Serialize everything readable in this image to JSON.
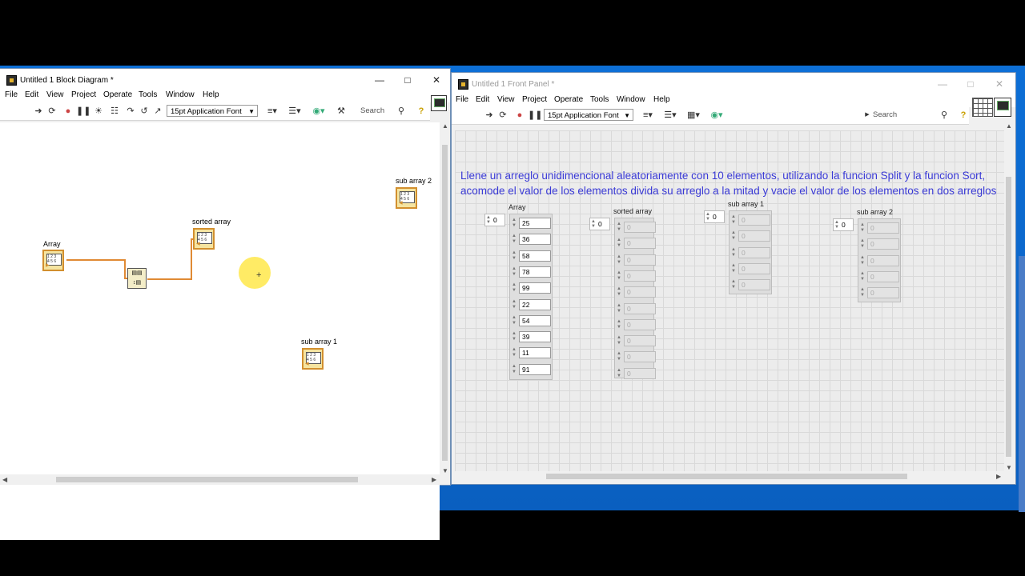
{
  "block_diagram": {
    "title": "Untitled 1 Block Diagram *",
    "menu": [
      "File",
      "Edit",
      "View",
      "Project",
      "Operate",
      "Tools",
      "Window",
      "Help"
    ],
    "font": "15pt Application Font",
    "search_placeholder": "Search",
    "terminals": {
      "array": "Array",
      "sorted": "sorted array",
      "sub1": "sub array 1",
      "sub2": "sub array 2"
    }
  },
  "front_panel": {
    "title": "Untitled 1 Front Panel *",
    "menu": [
      "File",
      "Edit",
      "View",
      "Project",
      "Operate",
      "Tools",
      "Window",
      "Help"
    ],
    "font": "15pt Application Font",
    "search_placeholder": "Search",
    "instructions_line1": "Llene un arreglo unidimencional aleatoriamente con 10 elementos, utilizando la funcion Split y la funcion Sort,",
    "instructions_line2": "acomode el valor de los elementos divida su arreglo a la mitad y vacie el valor de los elementos en dos arreglos",
    "arrays": {
      "array": {
        "label": "Array",
        "index": "0",
        "values": [
          "25",
          "36",
          "58",
          "78",
          "99",
          "22",
          "54",
          "39",
          "11",
          "91"
        ]
      },
      "sorted": {
        "label": "sorted array",
        "index": "0",
        "values": [
          "0",
          "0",
          "0",
          "0",
          "0",
          "0",
          "0",
          "0",
          "0",
          "0"
        ]
      },
      "sub1": {
        "label": "sub array 1",
        "index": "0",
        "values": [
          "0",
          "0",
          "0",
          "0",
          "0"
        ]
      },
      "sub2": {
        "label": "sub array 2",
        "index": "0",
        "values": [
          "0",
          "0",
          "0",
          "0",
          "0"
        ]
      }
    }
  }
}
